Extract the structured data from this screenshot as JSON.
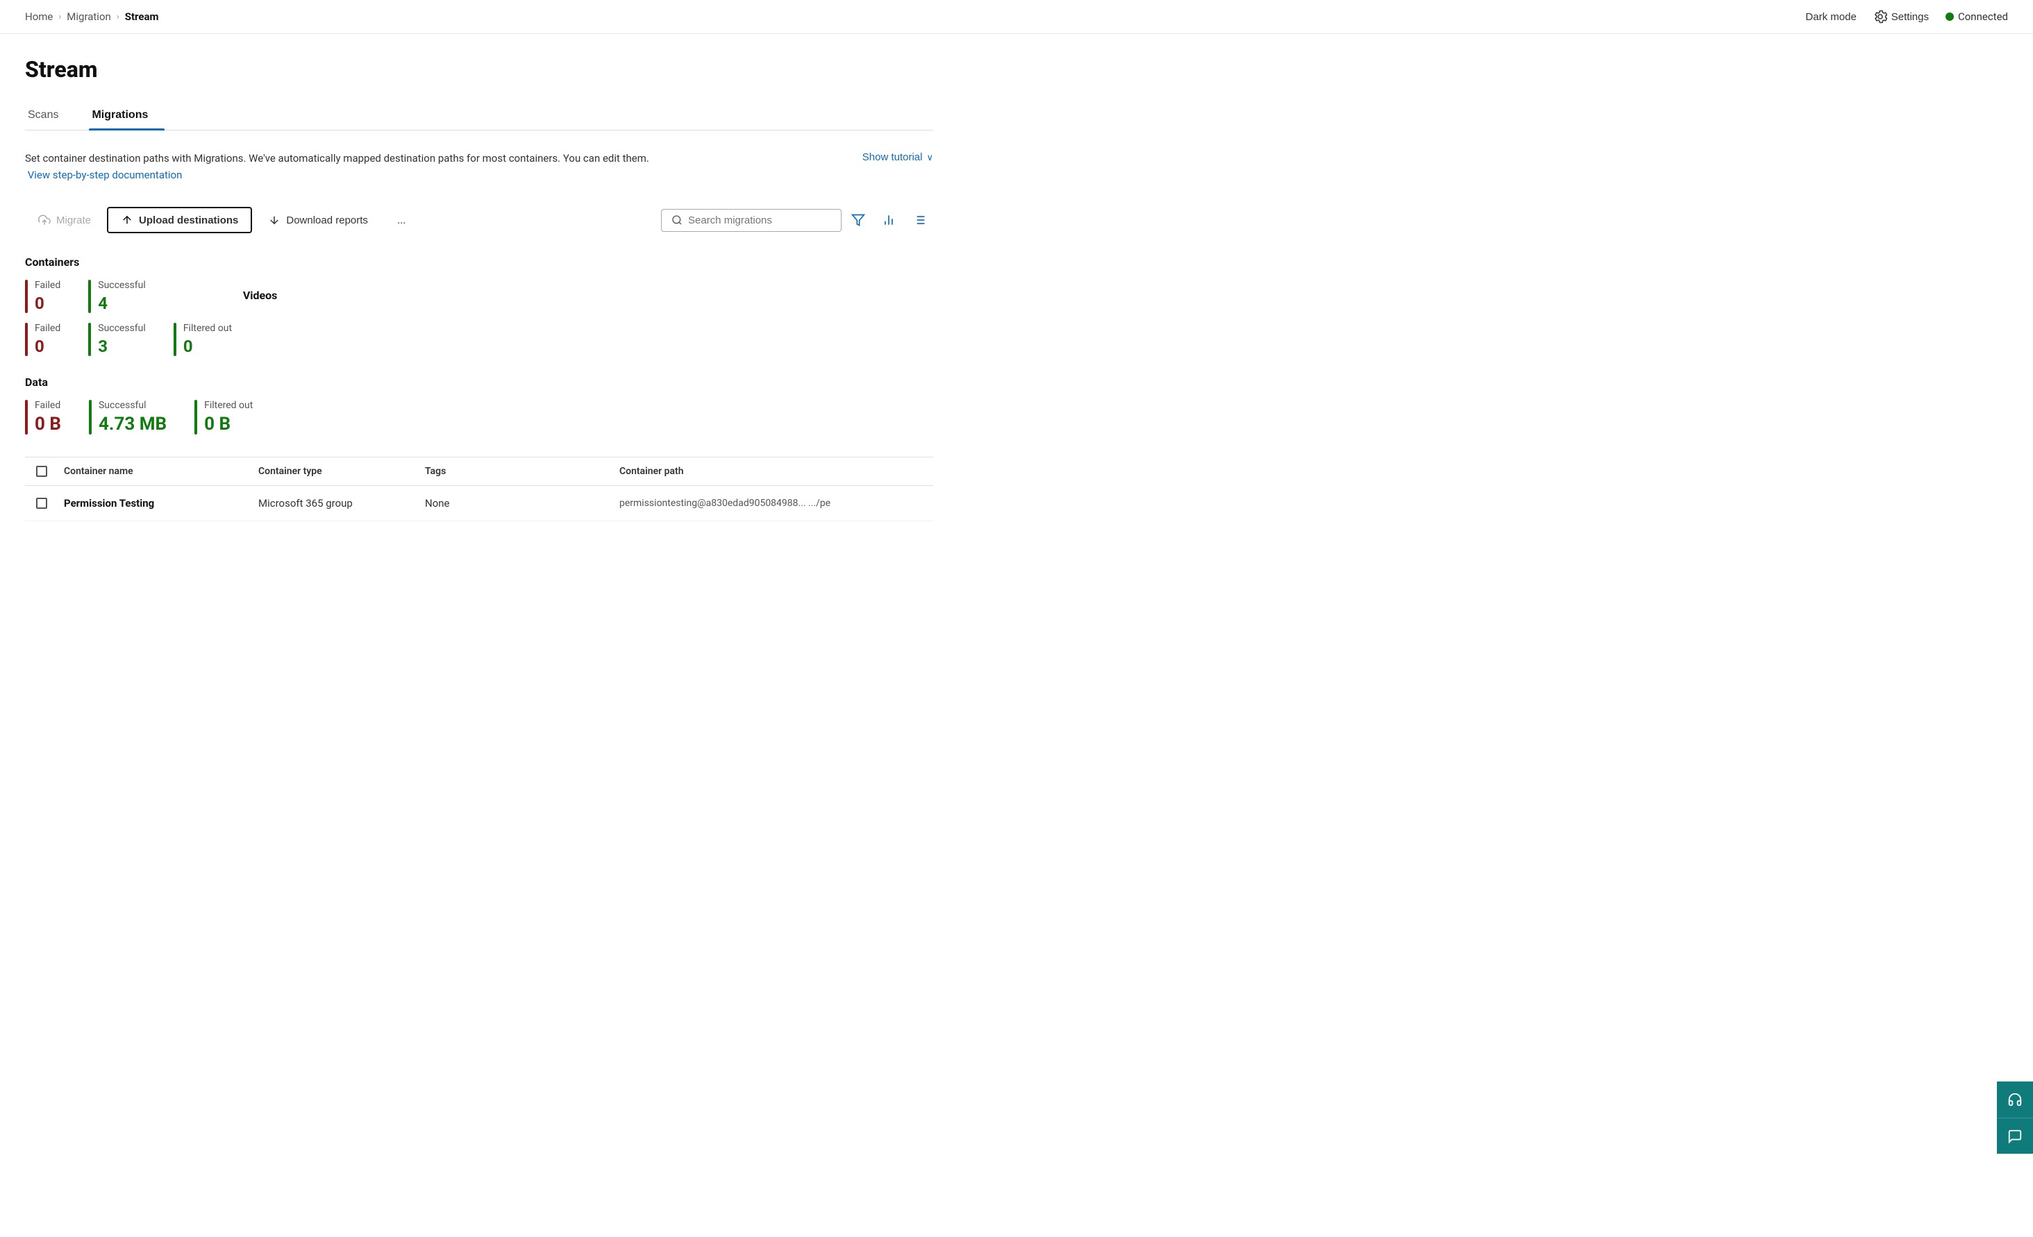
{
  "topbar": {
    "breadcrumb": {
      "home": "Home",
      "migration": "Migration",
      "current": "Stream",
      "sep1": ">",
      "sep2": ">"
    },
    "darkmode_label": "Dark mode",
    "settings_label": "Settings",
    "connected_label": "Connected"
  },
  "page": {
    "title": "Stream"
  },
  "tabs": [
    {
      "id": "scans",
      "label": "Scans",
      "active": false
    },
    {
      "id": "migrations",
      "label": "Migrations",
      "active": true
    }
  ],
  "description": {
    "text1": "Set container destination paths with Migrations. We've automatically mapped destination paths for most containers. You can edit them.",
    "link_label": "View step-by-step documentation",
    "show_tutorial": "Show tutorial"
  },
  "toolbar": {
    "migrate_label": "Migrate",
    "upload_label": "Upload destinations",
    "download_label": "Download reports",
    "more_label": "...",
    "search_placeholder": "Search migrations"
  },
  "stats": {
    "containers": {
      "label": "Containers",
      "items": [
        {
          "label": "Failed",
          "value": "0",
          "color": "red"
        },
        {
          "label": "Successful",
          "value": "4",
          "color": "green"
        }
      ]
    },
    "videos": {
      "label": "Videos",
      "items": [
        {
          "label": "Failed",
          "value": "0",
          "color": "red"
        },
        {
          "label": "Successful",
          "value": "3",
          "color": "green"
        },
        {
          "label": "Filtered out",
          "value": "0",
          "color": "green"
        }
      ]
    },
    "data": {
      "label": "Data",
      "items": [
        {
          "label": "Failed",
          "value": "0 B",
          "color": "red",
          "large": true
        },
        {
          "label": "Successful",
          "value": "4.73 MB",
          "color": "green",
          "large": true
        },
        {
          "label": "Filtered out",
          "value": "0 B",
          "color": "green",
          "large": true
        }
      ]
    }
  },
  "table": {
    "headers": [
      {
        "id": "select",
        "label": ""
      },
      {
        "id": "container-name",
        "label": "Container name"
      },
      {
        "id": "container-type",
        "label": "Container type"
      },
      {
        "id": "tags",
        "label": "Tags"
      },
      {
        "id": "container-path",
        "label": "Container path"
      }
    ],
    "rows": [
      {
        "container_name": "Permission Testing",
        "container_type": "Microsoft 365 group",
        "tags": "None",
        "container_path": "permissiontesting@a830edad905084988...   .../pe"
      }
    ]
  }
}
